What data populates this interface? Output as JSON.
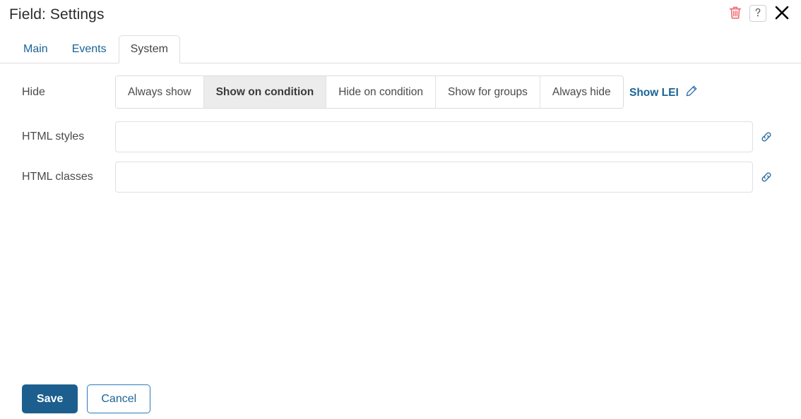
{
  "dialog": {
    "title": "Field: Settings",
    "header_actions": [
      {
        "name": "delete-button",
        "icon": "trash-icon",
        "color": "#f0606a"
      },
      {
        "name": "help-button",
        "icon": "question-mark-icon",
        "color": "#5a5a5a"
      },
      {
        "name": "close-button",
        "icon": "close-icon",
        "color": "#000000"
      }
    ]
  },
  "tabs": [
    {
      "label": "Main",
      "active": false
    },
    {
      "label": "Events",
      "active": false
    },
    {
      "label": "System",
      "active": true
    }
  ],
  "form": {
    "hide": {
      "label": "Hide",
      "options": [
        {
          "label": "Always show",
          "selected": false
        },
        {
          "label": "Show on condition",
          "selected": true
        },
        {
          "label": "Hide on condition",
          "selected": false
        },
        {
          "label": "Show for groups",
          "selected": false
        },
        {
          "label": "Always hide",
          "selected": false
        }
      ],
      "link": {
        "label": "Show LEI",
        "icon": "pencil-icon"
      }
    },
    "html_styles": {
      "label": "HTML styles",
      "value": "",
      "placeholder": "",
      "icon": "link-icon"
    },
    "html_classes": {
      "label": "HTML classes",
      "value": "",
      "placeholder": "",
      "icon": "link-icon"
    }
  },
  "footer": {
    "save_label": "Save",
    "cancel_label": "Cancel"
  },
  "colors": {
    "accent_blue": "#1a6496",
    "primary_button": "#1c5f8e",
    "danger": "#f0606a",
    "selected_segment_bg": "#ececec"
  }
}
